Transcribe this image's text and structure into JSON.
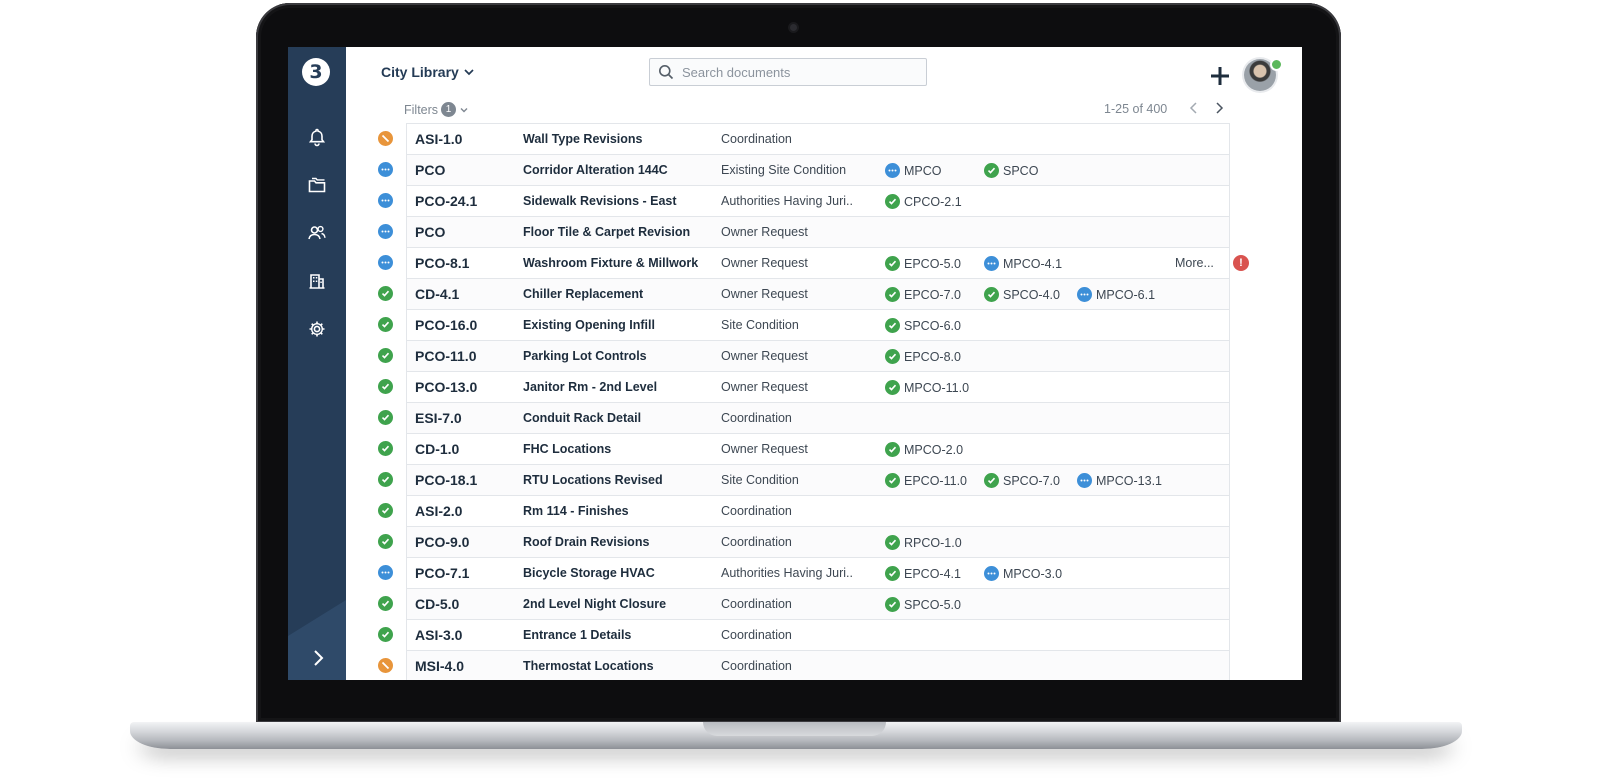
{
  "colors": {
    "sidebar": "#263d58",
    "approved": "#3fa34d",
    "pending": "#3d8fd8",
    "voided": "#e8953b",
    "alert": "#d9534f"
  },
  "app": {
    "logo": "3",
    "workspace": "City Library",
    "search_placeholder": "Search documents",
    "filters_label": "Filters",
    "filters_count": "1",
    "pager_text": "1-25 of 400",
    "more_label": "More...",
    "alert_symbol": "!"
  },
  "sidebar": {
    "items": [
      {
        "name": "bell-icon"
      },
      {
        "name": "folder-icon"
      },
      {
        "name": "users-icon"
      },
      {
        "name": "building-icon"
      },
      {
        "name": "gear-icon"
      }
    ],
    "expand_icon": "chevron-right-icon"
  },
  "rows": [
    {
      "status": "voided",
      "id": "ASI-1.0",
      "title": "Wall Type Revisions",
      "type": "Coordination",
      "tags": []
    },
    {
      "status": "pending",
      "id": "PCO",
      "title": "Corridor Alteration 144C",
      "type": "Existing Site Condition",
      "tags": [
        {
          "status": "pending",
          "label": "MPCO"
        },
        {
          "status": "approved",
          "label": "SPCO"
        }
      ]
    },
    {
      "status": "pending",
      "id": "PCO-24.1",
      "title": "Sidewalk Revisions - East",
      "type": "Authorities Having Juri..",
      "tags": [
        {
          "status": "approved",
          "label": "CPCO-2.1"
        }
      ]
    },
    {
      "status": "pending",
      "id": "PCO",
      "title": "Floor Tile & Carpet Revision",
      "type": "Owner Request",
      "tags": []
    },
    {
      "status": "pending",
      "id": "PCO-8.1",
      "title": "Washroom Fixture & Millwork",
      "type": "Owner Request",
      "tags": [
        {
          "status": "approved",
          "label": "EPCO-5.0"
        },
        {
          "status": "pending",
          "label": "MPCO-4.1"
        }
      ],
      "more": true,
      "alert": true
    },
    {
      "status": "approved",
      "id": "CD-4.1",
      "title": "Chiller Replacement",
      "type": "Owner Request",
      "tags": [
        {
          "status": "approved",
          "label": "EPCO-7.0"
        },
        {
          "status": "approved",
          "label": "SPCO-4.0"
        },
        {
          "status": "pending",
          "label": "MPCO-6.1"
        }
      ]
    },
    {
      "status": "approved",
      "id": "PCO-16.0",
      "title": "Existing Opening Infill",
      "type": "Site Condition",
      "tags": [
        {
          "status": "approved",
          "label": "SPCO-6.0"
        }
      ]
    },
    {
      "status": "approved",
      "id": "PCO-11.0",
      "title": "Parking Lot Controls",
      "type": "Owner Request",
      "tags": [
        {
          "status": "approved",
          "label": "EPCO-8.0"
        }
      ]
    },
    {
      "status": "approved",
      "id": "PCO-13.0",
      "title": "Janitor Rm - 2nd Level",
      "type": "Owner Request",
      "tags": [
        {
          "status": "approved",
          "label": "MPCO-11.0"
        }
      ]
    },
    {
      "status": "approved",
      "id": "ESI-7.0",
      "title": "Conduit Rack Detail",
      "type": "Coordination",
      "tags": []
    },
    {
      "status": "approved",
      "id": "CD-1.0",
      "title": "FHC Locations",
      "type": "Owner Request",
      "tags": [
        {
          "status": "approved",
          "label": "MPCO-2.0"
        }
      ]
    },
    {
      "status": "approved",
      "id": "PCO-18.1",
      "title": "RTU Locations Revised",
      "type": "Site Condition",
      "tags": [
        {
          "status": "approved",
          "label": "EPCO-11.0"
        },
        {
          "status": "approved",
          "label": "SPCO-7.0"
        },
        {
          "status": "pending",
          "label": "MPCO-13.1"
        }
      ]
    },
    {
      "status": "approved",
      "id": "ASI-2.0",
      "title": "Rm 114 - Finishes",
      "type": "Coordination",
      "tags": []
    },
    {
      "status": "approved",
      "id": "PCO-9.0",
      "title": "Roof Drain Revisions",
      "type": "Coordination",
      "tags": [
        {
          "status": "approved",
          "label": "RPCO-1.0"
        }
      ]
    },
    {
      "status": "pending",
      "id": "PCO-7.1",
      "title": "Bicycle Storage HVAC",
      "type": "Authorities Having Juri..",
      "tags": [
        {
          "status": "approved",
          "label": "EPCO-4.1"
        },
        {
          "status": "pending",
          "label": "MPCO-3.0"
        }
      ]
    },
    {
      "status": "approved",
      "id": "CD-5.0",
      "title": "2nd Level Night Closure",
      "type": "Coordination",
      "tags": [
        {
          "status": "approved",
          "label": "SPCO-5.0"
        }
      ]
    },
    {
      "status": "approved",
      "id": "ASI-3.0",
      "title": "Entrance 1 Details",
      "type": "Coordination",
      "tags": []
    },
    {
      "status": "voided",
      "id": "MSI-4.0",
      "title": "Thermostat Locations",
      "type": "Coordination",
      "tags": []
    }
  ]
}
